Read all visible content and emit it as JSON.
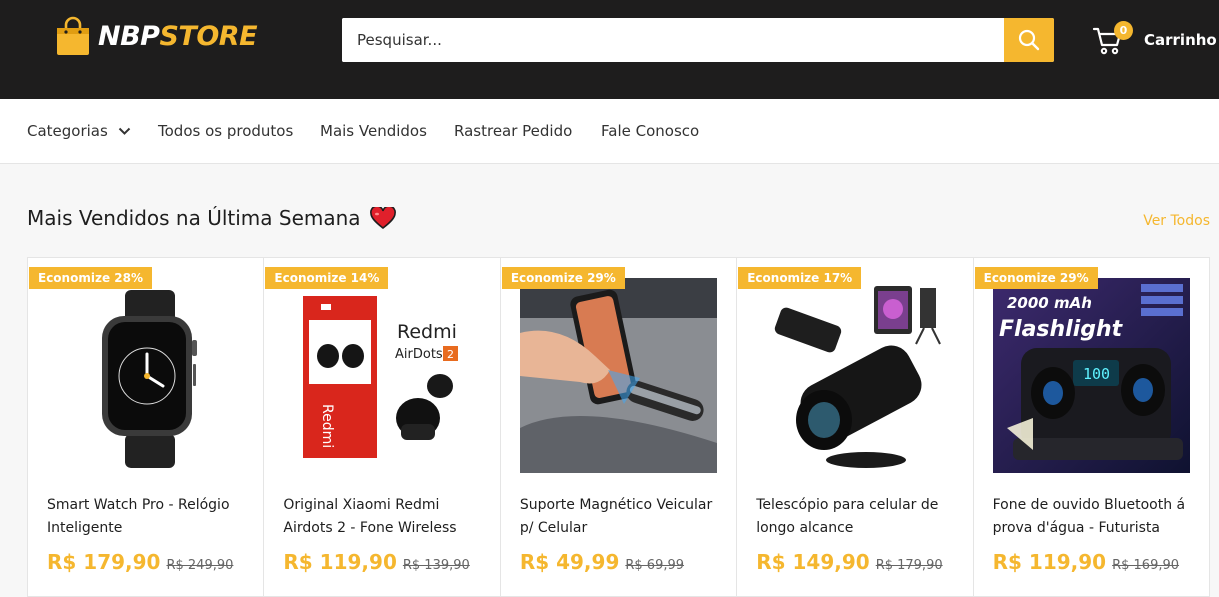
{
  "header": {
    "logo": {
      "part1": "NBP",
      "part2": "STORE"
    },
    "search": {
      "placeholder": "Pesquisar..."
    },
    "cart": {
      "label": "Carrinho",
      "count": "0"
    }
  },
  "nav": {
    "items": [
      {
        "label": "Categorias"
      },
      {
        "label": "Todos os produtos"
      },
      {
        "label": "Mais Vendidos"
      },
      {
        "label": "Rastrear Pedido"
      },
      {
        "label": "Fale Conosco"
      }
    ]
  },
  "section": {
    "title": "Mais Vendidos na Última Semana",
    "view_all": "Ver Todos"
  },
  "products": [
    {
      "badge": "Economize 28%",
      "title": "Smart Watch Pro - Relógio Inteligente",
      "price": "R$ 179,90",
      "old_price": "R$ 249,90"
    },
    {
      "badge": "Economize 14%",
      "title": "Original Xiaomi Redmi Airdots 2 - Fone Wireless",
      "price": "R$ 119,90",
      "old_price": "R$ 139,90",
      "image_text": {
        "brand": "Redmi",
        "model": "AirDots",
        "num": "2",
        "side": "Redmi"
      }
    },
    {
      "badge": "Economize 29%",
      "title": "Suporte Magnético Veicular p/ Celular",
      "price": "R$ 49,99",
      "old_price": "R$ 69,99"
    },
    {
      "badge": "Economize 17%",
      "title": "Telescópio para celular de longo alcance",
      "price": "R$ 149,90",
      "old_price": "R$ 179,90"
    },
    {
      "badge": "Economize 29%",
      "title": "Fone de ouvido Bluetooth á prova d'água - Futurista",
      "price": "R$ 119,90",
      "old_price": "R$ 169,90",
      "image_text": {
        "capacity": "2000 mAh",
        "feature": "Flashlight",
        "display": "100"
      }
    }
  ],
  "colors": {
    "accent": "#f5b72f",
    "header_bg": "#1e1d1d"
  },
  "icons": [
    "shopping-bag-icon",
    "search-icon",
    "cart-icon",
    "chevron-down-icon",
    "heart-icon"
  ]
}
